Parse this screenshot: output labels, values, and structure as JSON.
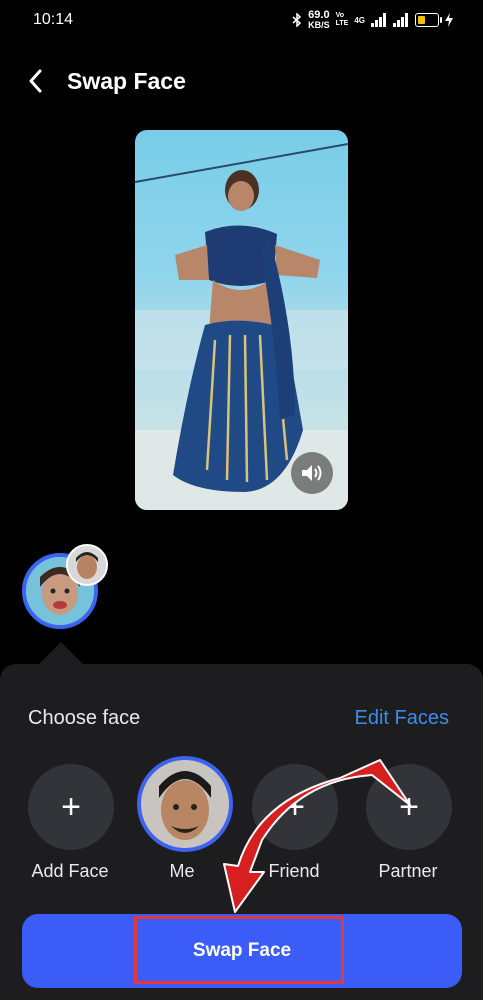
{
  "status": {
    "time": "10:14",
    "speed_value": "69.0",
    "speed_unit": "KB/S",
    "network_tag1": "Vo",
    "network_tag2": "LTE",
    "network_4g": "4G"
  },
  "header": {
    "back_icon": "chevron-left-icon",
    "title": "Swap Face"
  },
  "preview": {
    "sound_icon": "speaker-icon"
  },
  "sheet": {
    "choose_label": "Choose face",
    "edit_label": "Edit Faces",
    "faces": [
      {
        "label": "Add Face",
        "icon": "+"
      },
      {
        "label": "Me"
      },
      {
        "label": "Friend",
        "icon": "+"
      },
      {
        "label": "Partner",
        "icon": "+"
      }
    ],
    "swap_button": "Swap Face"
  },
  "colors": {
    "accent": "#3b5cf6",
    "link": "#3a8de8",
    "annotation": "#e23a3a",
    "sheet_bg": "#1d1d20"
  }
}
